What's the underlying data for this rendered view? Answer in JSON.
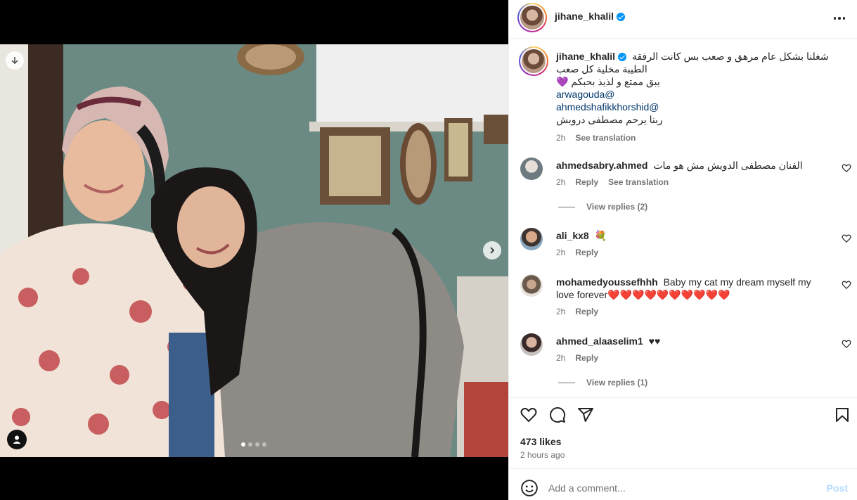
{
  "post": {
    "author": "jihane_khalil",
    "verified": true,
    "media": {
      "slide_count": 4,
      "active_slide": 1
    },
    "caption": {
      "lines": [
        "شغلنا بشكل عام مرهق و صعب بس كانت الرفقة",
        "الطيبة مخلية كل صعب",
        "يبق ممتع و لذيذ بحبكم 💜",
        "arwagouda@",
        "ahmedshafikkhorshid@",
        "ربنا يرحم مصطفى درويش"
      ],
      "time": "2h",
      "see_translation": "See translation"
    },
    "comments": [
      {
        "username": "ahmedsabry.ahmed",
        "text": "الفنان مصطفى الدويش مش هو مات",
        "time": "2h",
        "reply": "Reply",
        "see_translation": "See translation",
        "view_replies": "View replies (2)"
      },
      {
        "username": "ali_kx8",
        "text": "💐",
        "time": "2h",
        "reply": "Reply"
      },
      {
        "username": "mohamedyoussefhhh",
        "text": "Baby my cat my dream myself my love forever❤️❤️❤️❤️❤️❤️❤️❤️❤️❤️",
        "time": "2h",
        "reply": "Reply"
      },
      {
        "username": "ahmed_alaaselim1",
        "text": "♥♥",
        "time": "2h",
        "reply": "Reply",
        "view_replies": "View replies (1)"
      }
    ],
    "likes": "473 likes",
    "posted_ago": "2 hours ago",
    "add_comment": {
      "placeholder": "Add a comment...",
      "post_label": "Post"
    }
  },
  "icons": {
    "more": "more-horizontal-icon",
    "like": "heart-icon",
    "comment": "comment-icon",
    "share": "send-icon",
    "save": "bookmark-icon",
    "emoji": "emoji-icon",
    "next": "chevron-right-icon",
    "download": "arrow-down-icon",
    "tagged": "user-icon"
  },
  "colors": {
    "verified": "#0095f6",
    "link": "#00376b",
    "muted": "#737373",
    "post_disabled": "#b3dbff"
  }
}
